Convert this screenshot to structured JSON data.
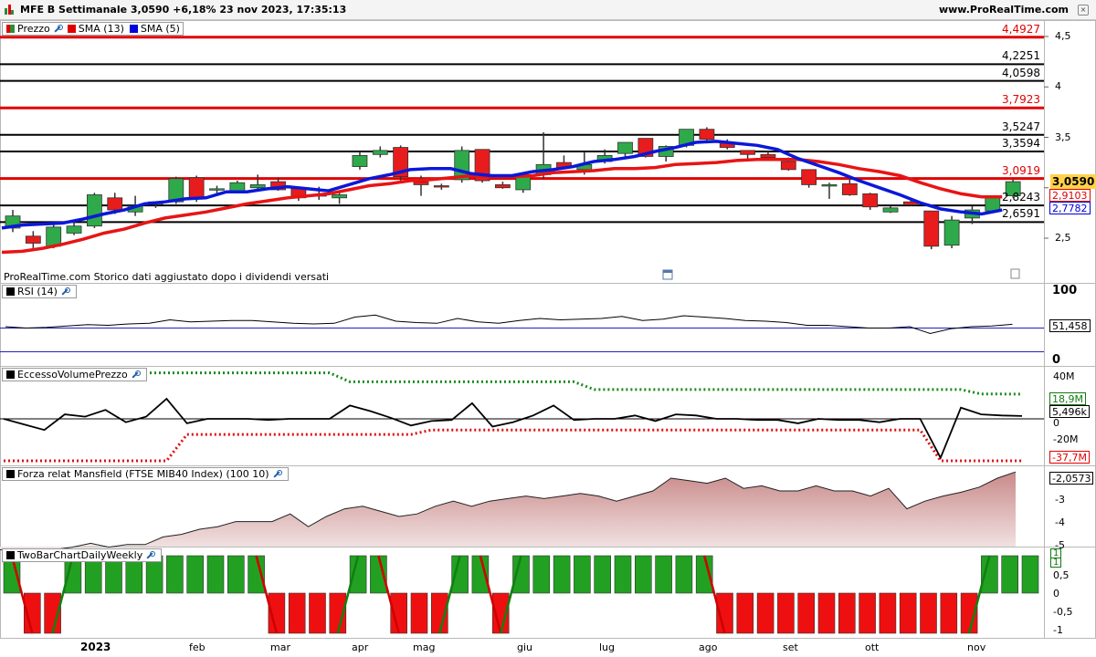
{
  "header": {
    "title": "MFE B Settimanale 3,0590 +6,18% 23 nov 2023, 17:35:13",
    "site": "www.ProRealTime.com",
    "close_icon": "close-icon"
  },
  "price_panel": {
    "legend": [
      {
        "label": "Prezzo",
        "color": "#2e8b3a"
      },
      {
        "label": "SMA (13)",
        "color": "#e00000"
      },
      {
        "label": "SMA (5)",
        "color": "#0000dd"
      }
    ],
    "note": "ProRealTime.com Storico dati aggiustato dopo i dividendi versati",
    "axis_ticks": [
      "4,5",
      "4",
      "3,5",
      "3",
      "2,5"
    ],
    "horizontal_levels": [
      {
        "label": "4,4927",
        "value": 4.4927,
        "color": "#e00000"
      },
      {
        "label": "4,2251",
        "value": 4.2251,
        "color": "#000000"
      },
      {
        "label": "4,0598",
        "value": 4.0598,
        "color": "#000000"
      },
      {
        "label": "3,7923",
        "value": 3.7923,
        "color": "#e00000"
      },
      {
        "label": "3,5247",
        "value": 3.5247,
        "color": "#000000"
      },
      {
        "label": "3,3594",
        "value": 3.3594,
        "color": "#000000"
      },
      {
        "label": "3,0919",
        "value": 3.0919,
        "color": "#e00000"
      },
      {
        "label": "2,8243",
        "value": 2.8243,
        "color": "#000000"
      },
      {
        "label": "2,6591",
        "value": 2.6591,
        "color": "#000000"
      }
    ],
    "last_price_tag": "3,0590",
    "sma13_tag": "2,9103",
    "sma5_tag": "2,7782"
  },
  "rsi_panel": {
    "legend": "RSI (14)",
    "axis_ticks": [
      "100",
      "0"
    ],
    "value_tag": "51,458"
  },
  "volume_panel": {
    "legend": "EccessoVolumePrezzo",
    "axis_ticks": [
      "40M",
      "0",
      "-20M"
    ],
    "upper_tag": "18,9M",
    "value_tag": "5,496k",
    "lower_tag": "-37,7M"
  },
  "mansfield_panel": {
    "legend": "Forza relat Mansfield (FTSE MIB40 Index) (100 10)",
    "axis_ticks": [
      "-3",
      "-4",
      "-5"
    ],
    "value_tag": "-2,0573"
  },
  "twobar_panel": {
    "legend": "TwoBarChartDailyWeekly",
    "axis_ticks": [
      "0,5",
      "0",
      "-0,5",
      "-1"
    ],
    "top_tag": "1",
    "top_tag2": "1"
  },
  "x_axis": {
    "year": "2023",
    "months": [
      "feb",
      "mar",
      "apr",
      "mag",
      "giu",
      "lug",
      "ago",
      "set",
      "ott",
      "nov"
    ]
  },
  "chart_data": [
    {
      "type": "candlestick",
      "title": "MFE B Settimanale",
      "ylim": [
        2.2,
        4.55
      ],
      "candles": [
        {
          "o": 2.6,
          "h": 2.78,
          "l": 2.56,
          "c": 2.72
        },
        {
          "o": 2.52,
          "h": 2.57,
          "l": 2.38,
          "c": 2.45
        },
        {
          "o": 2.42,
          "h": 2.64,
          "l": 2.4,
          "c": 2.61
        },
        {
          "o": 2.55,
          "h": 2.66,
          "l": 2.53,
          "c": 2.62
        },
        {
          "o": 2.62,
          "h": 2.95,
          "l": 2.6,
          "c": 2.93
        },
        {
          "o": 2.9,
          "h": 2.95,
          "l": 2.74,
          "c": 2.78
        },
        {
          "o": 2.76,
          "h": 2.92,
          "l": 2.72,
          "c": 2.82
        },
        {
          "o": 2.84,
          "h": 2.86,
          "l": 2.8,
          "c": 2.86
        },
        {
          "o": 2.86,
          "h": 3.11,
          "l": 2.84,
          "c": 3.09
        },
        {
          "o": 3.1,
          "h": 3.12,
          "l": 2.86,
          "c": 2.9
        },
        {
          "o": 2.99,
          "h": 3.02,
          "l": 2.93,
          "c": 2.99
        },
        {
          "o": 2.97,
          "h": 3.07,
          "l": 2.95,
          "c": 3.05
        },
        {
          "o": 3.0,
          "h": 3.13,
          "l": 2.97,
          "c": 3.03
        },
        {
          "o": 3.06,
          "h": 3.1,
          "l": 2.97,
          "c": 2.98
        },
        {
          "o": 2.99,
          "h": 3.0,
          "l": 2.87,
          "c": 2.9
        },
        {
          "o": 2.93,
          "h": 3.01,
          "l": 2.88,
          "c": 2.93
        },
        {
          "o": 2.9,
          "h": 2.95,
          "l": 2.84,
          "c": 2.93
        },
        {
          "o": 3.21,
          "h": 3.36,
          "l": 3.18,
          "c": 3.32
        },
        {
          "o": 3.33,
          "h": 3.41,
          "l": 3.3,
          "c": 3.37
        },
        {
          "o": 3.4,
          "h": 3.42,
          "l": 3.07,
          "c": 3.11
        },
        {
          "o": 3.06,
          "h": 3.12,
          "l": 2.92,
          "c": 3.03
        },
        {
          "o": 3.02,
          "h": 3.04,
          "l": 2.98,
          "c": 3.01
        },
        {
          "o": 3.08,
          "h": 3.41,
          "l": 3.05,
          "c": 3.37
        },
        {
          "o": 3.38,
          "h": 3.38,
          "l": 3.05,
          "c": 3.07
        },
        {
          "o": 3.03,
          "h": 3.06,
          "l": 2.99,
          "c": 3.0
        },
        {
          "o": 2.98,
          "h": 3.15,
          "l": 2.95,
          "c": 3.12
        },
        {
          "o": 3.13,
          "h": 3.55,
          "l": 3.09,
          "c": 3.23
        },
        {
          "o": 3.25,
          "h": 3.32,
          "l": 3.2,
          "c": 3.2
        },
        {
          "o": 3.18,
          "h": 3.36,
          "l": 3.13,
          "c": 3.23
        },
        {
          "o": 3.26,
          "h": 3.38,
          "l": 3.24,
          "c": 3.32
        },
        {
          "o": 3.34,
          "h": 3.45,
          "l": 3.3,
          "c": 3.45
        },
        {
          "o": 3.49,
          "h": 3.49,
          "l": 3.3,
          "c": 3.31
        },
        {
          "o": 3.31,
          "h": 3.42,
          "l": 3.26,
          "c": 3.41
        },
        {
          "o": 3.42,
          "h": 3.58,
          "l": 3.4,
          "c": 3.58
        },
        {
          "o": 3.58,
          "h": 3.6,
          "l": 3.44,
          "c": 3.48
        },
        {
          "o": 3.45,
          "h": 3.48,
          "l": 3.38,
          "c": 3.4
        },
        {
          "o": 3.37,
          "h": 3.37,
          "l": 3.27,
          "c": 3.33
        },
        {
          "o": 3.33,
          "h": 3.37,
          "l": 3.28,
          "c": 3.3
        },
        {
          "o": 3.26,
          "h": 3.3,
          "l": 3.17,
          "c": 3.18
        },
        {
          "o": 3.18,
          "h": 3.18,
          "l": 3.0,
          "c": 3.03
        },
        {
          "o": 3.03,
          "h": 3.05,
          "l": 2.89,
          "c": 3.03
        },
        {
          "o": 3.04,
          "h": 3.08,
          "l": 2.92,
          "c": 2.93
        },
        {
          "o": 2.94,
          "h": 2.95,
          "l": 2.78,
          "c": 2.81
        },
        {
          "o": 2.76,
          "h": 2.82,
          "l": 2.75,
          "c": 2.8
        },
        {
          "o": 2.86,
          "h": 2.88,
          "l": 2.82,
          "c": 2.83
        },
        {
          "o": 2.77,
          "h": 2.77,
          "l": 2.39,
          "c": 2.42
        },
        {
          "o": 2.43,
          "h": 2.72,
          "l": 2.4,
          "c": 2.68
        },
        {
          "o": 2.7,
          "h": 2.82,
          "l": 2.64,
          "c": 2.78
        },
        {
          "o": 2.77,
          "h": 2.91,
          "l": 2.75,
          "c": 2.9
        },
        {
          "o": 2.92,
          "h": 3.08,
          "l": 2.9,
          "c": 3.06
        }
      ],
      "sma13": [
        2.36,
        2.37,
        2.4,
        2.44,
        2.49,
        2.55,
        2.59,
        2.65,
        2.7,
        2.73,
        2.76,
        2.8,
        2.84,
        2.87,
        2.9,
        2.92,
        2.94,
        2.98,
        3.02,
        3.04,
        3.07,
        3.08,
        3.1,
        3.12,
        3.11,
        3.11,
        3.12,
        3.15,
        3.16,
        3.17,
        3.19,
        3.19,
        3.2,
        3.23,
        3.24,
        3.25,
        3.27,
        3.28,
        3.28,
        3.28,
        3.26,
        3.23,
        3.19,
        3.16,
        3.12,
        3.05,
        2.99,
        2.94,
        2.91,
        2.91
      ],
      "sma5": [
        2.6,
        2.63,
        2.64,
        2.65,
        2.69,
        2.74,
        2.78,
        2.84,
        2.86,
        2.89,
        2.9,
        2.96,
        2.96,
        2.99,
        3.01,
        2.99,
        2.97,
        3.03,
        3.09,
        3.13,
        3.18,
        3.19,
        3.19,
        3.14,
        3.12,
        3.12,
        3.16,
        3.18,
        3.21,
        3.26,
        3.28,
        3.31,
        3.36,
        3.4,
        3.45,
        3.46,
        3.44,
        3.42,
        3.38,
        3.29,
        3.22,
        3.15,
        3.07,
        3.0,
        2.93,
        2.85,
        2.79,
        2.76,
        2.74,
        2.78
      ]
    },
    {
      "type": "line",
      "title": "RSI (14)",
      "ylim": [
        0,
        100
      ],
      "levels": [
        70,
        30
      ],
      "values": [
        48,
        46,
        47,
        49,
        51,
        50,
        52,
        53,
        58,
        55,
        56,
        57,
        57,
        55,
        53,
        52,
        53,
        62,
        65,
        56,
        54,
        53,
        60,
        55,
        53,
        57,
        60,
        58,
        59,
        60,
        63,
        57,
        59,
        64,
        62,
        60,
        57,
        56,
        54,
        50,
        50,
        48,
        46,
        46,
        48,
        38,
        45,
        48,
        49,
        51.458
      ]
    },
    {
      "type": "line",
      "title": "EccessoVolumePrezzo",
      "ylim": [
        -42,
        44
      ],
      "values": [
        0,
        -5,
        -10,
        4,
        2,
        8,
        -3,
        2,
        18,
        -4,
        0,
        0,
        0,
        -1,
        0,
        0,
        0,
        12,
        7,
        1,
        -6,
        -2,
        -1,
        14,
        -7,
        -3,
        3,
        12,
        -1,
        0,
        0,
        3,
        -2,
        4,
        3,
        0,
        0,
        -1,
        -1,
        -4,
        0,
        -1,
        -1,
        -3,
        0,
        0,
        -35,
        10,
        4,
        3,
        2.5
      ],
      "upper_band": [
        38,
        38,
        38,
        38,
        38,
        38,
        38,
        38,
        38,
        38,
        38,
        38,
        38,
        38,
        38,
        38,
        38,
        30,
        30,
        30,
        30,
        30,
        30,
        30,
        30,
        30,
        30,
        30,
        30,
        23,
        23,
        23,
        23,
        23,
        23,
        23,
        23,
        23,
        23,
        23,
        23,
        23,
        23,
        23,
        23,
        23,
        23,
        23,
        19,
        19,
        18.9
      ],
      "lower_band": [
        -37.7,
        -37.7,
        -37.7,
        -37.7,
        -37.7,
        -37.7,
        -37.7,
        -37.7,
        -37.7,
        -14,
        -14,
        -14,
        -14,
        -14,
        -14,
        -14,
        -14,
        -14,
        -14,
        -14,
        -14,
        -10,
        -10,
        -10,
        -10,
        -10,
        -10,
        -10,
        -10,
        -10,
        -10,
        -10,
        -10,
        -10,
        -10,
        -10,
        -10,
        -10,
        -10,
        -10,
        -10,
        -10,
        -10,
        -10,
        -10,
        -10,
        -37.7,
        -37.7,
        -37.7,
        -37.7,
        -37.7
      ]
    },
    {
      "type": "area",
      "title": "Forza relat Mansfield (FTSE MIB40 Index) (100 10)",
      "ylim": [
        -5.4,
        -1.8
      ],
      "values": [
        -5.1,
        -5.2,
        -5.3,
        -5.1,
        -5.0,
        -4.85,
        -5.0,
        -4.9,
        -4.9,
        -4.6,
        -4.5,
        -4.3,
        -4.2,
        -4.0,
        -4.0,
        -4.0,
        -3.7,
        -4.2,
        -3.8,
        -3.5,
        -3.4,
        -3.6,
        -3.8,
        -3.7,
        -3.4,
        -3.2,
        -3.4,
        -3.2,
        -3.1,
        -3.0,
        -3.1,
        -3.0,
        -2.9,
        -3.0,
        -3.2,
        -3.0,
        -2.8,
        -2.3,
        -2.4,
        -2.5,
        -2.3,
        -2.7,
        -2.6,
        -2.8,
        -2.8,
        -2.6,
        -2.8,
        -2.8,
        -3.0,
        -2.7,
        -3.5,
        -3.2,
        -3.0,
        -2.85,
        -2.65,
        -2.3,
        -2.0573
      ]
    },
    {
      "type": "bar",
      "title": "TwoBarChartDailyWeekly",
      "ylim": [
        -1.1,
        1.1
      ],
      "values": [
        1,
        -1,
        -1,
        1,
        1,
        1,
        1,
        1,
        1,
        1,
        1,
        1,
        1,
        -1,
        -1,
        -1,
        -1,
        1,
        1,
        -1,
        -1,
        -1,
        1,
        1,
        -1,
        1,
        1,
        1,
        1,
        1,
        1,
        1,
        1,
        1,
        1,
        -1,
        -1,
        -1,
        -1,
        -1,
        -1,
        -1,
        -1,
        -1,
        -1,
        -1,
        -1,
        -1,
        1,
        1,
        1
      ]
    }
  ]
}
